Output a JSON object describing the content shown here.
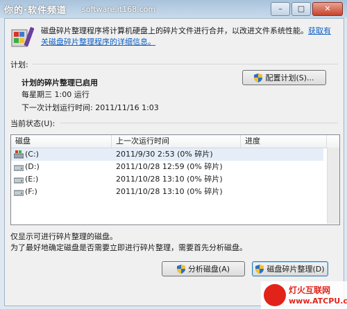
{
  "watermark": {
    "site_cn": "你的·软件频道",
    "url": "software.it168.com"
  },
  "window_buttons": {
    "minimize": "–",
    "maximize": "□",
    "close": "✕"
  },
  "intro": {
    "text": "磁盘碎片整理程序将计算机硬盘上的碎片文件进行合并，以改进文件系统性能。",
    "link": "获取有关磁盘碎片整理程序的详细信息。"
  },
  "schedule": {
    "section_label": "计划:",
    "title": "计划的碎片整理已启用",
    "run_time": "每星期三 1:00 运行",
    "next_run": "下一次计划运行时间: 2011/11/16 1:03",
    "config_button": "配置计划(S)..."
  },
  "status": {
    "section_label": "当前状态(U):",
    "columns": [
      "磁盘",
      "上一次运行时间",
      "进度"
    ],
    "rows": [
      {
        "disk": "(C:)",
        "last_run": "2011/9/30 2:53 (0% 碎片)",
        "progress": ""
      },
      {
        "disk": "(D:)",
        "last_run": "2011/10/28 12:59 (0% 碎片)",
        "progress": ""
      },
      {
        "disk": "(E:)",
        "last_run": "2011/10/28 13:10 (0% 碎片)",
        "progress": ""
      },
      {
        "disk": "(F:)",
        "last_run": "2011/10/28 13:10 (0% 碎片)",
        "progress": ""
      }
    ]
  },
  "footnote": {
    "line1": "仅显示可进行碎片整理的磁盘。",
    "line2": "为了最好地确定磁盘是否需要立即进行碎片整理，需要首先分析磁盘。"
  },
  "actions": {
    "analyze": "分析磁盘(A)",
    "defragment": "磁盘碎片整理(D)"
  },
  "watermark2": {
    "name": "灯火互联网",
    "url": "www.ATCPU.com"
  },
  "colors": {
    "link": "#0e5fc4",
    "selected_row": "#e5eef8",
    "watermark_red": "#e2231a"
  }
}
